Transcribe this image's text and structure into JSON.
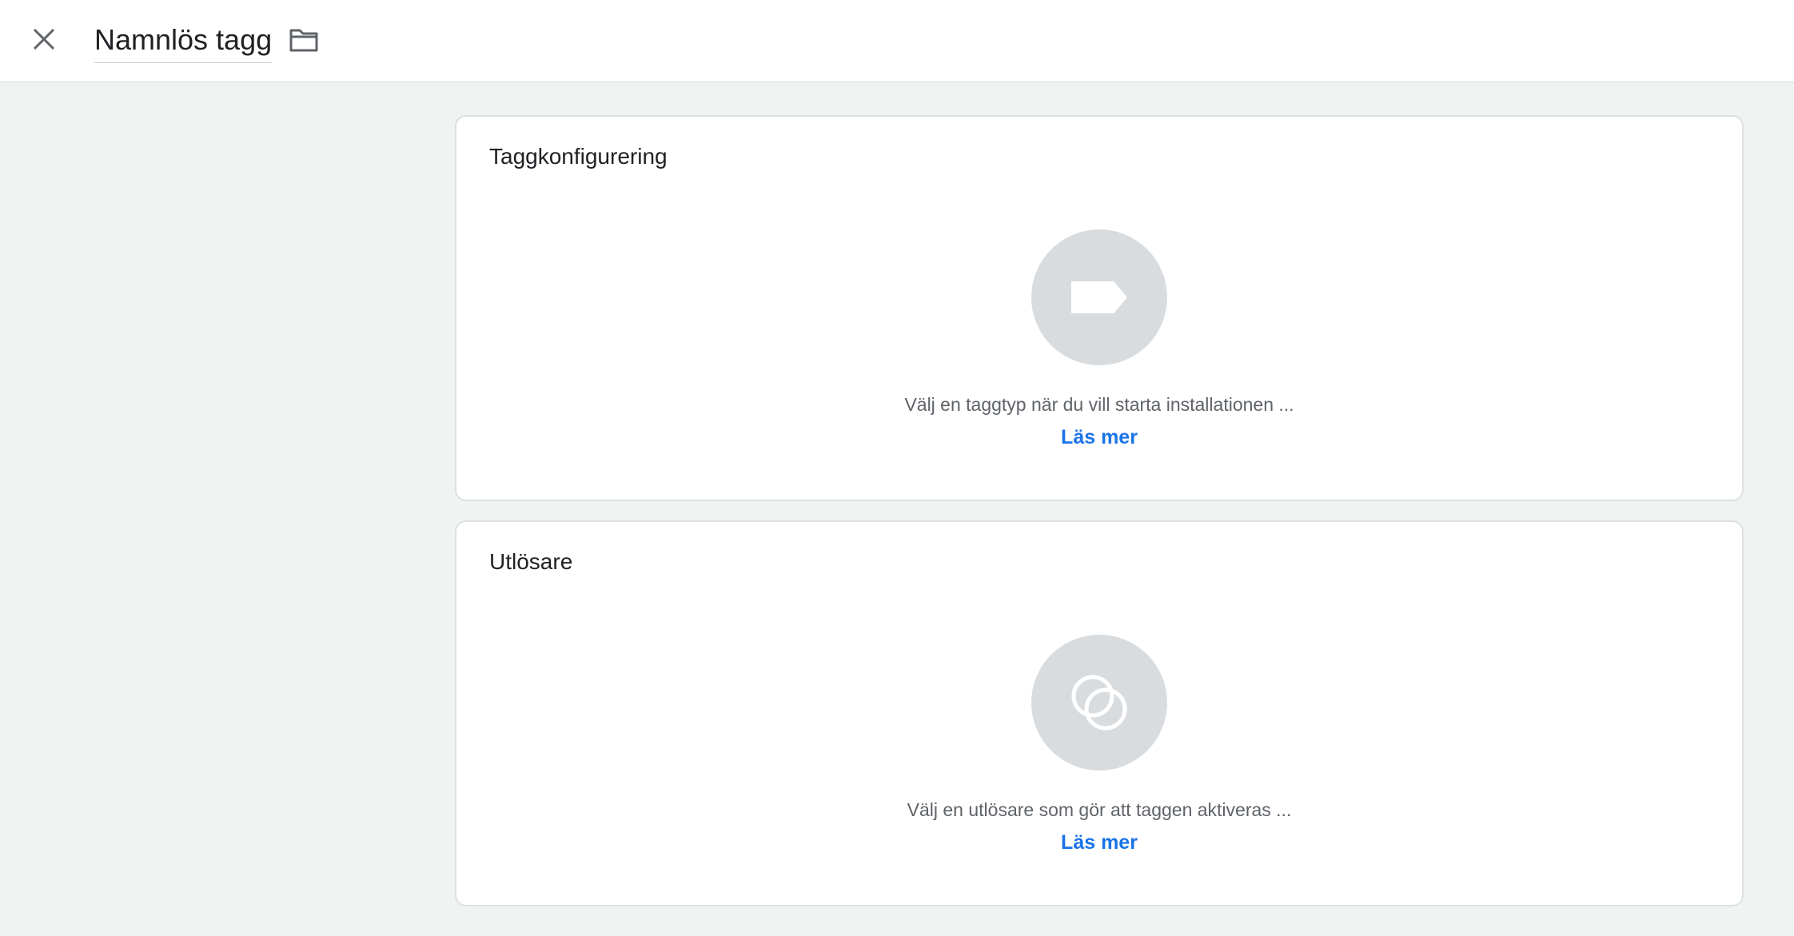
{
  "header": {
    "title": "Namnlös tagg",
    "close_icon": "close-icon",
    "folder_icon": "folder-icon"
  },
  "tag_config": {
    "title": "Taggkonfigurering",
    "icon": "tag-icon",
    "description": "Välj en taggtyp när du vill starta installationen ...",
    "link": "Läs mer"
  },
  "triggers": {
    "title": "Utlösare",
    "icon": "trigger-icon",
    "description": "Välj en utlösare som gör att taggen aktiveras ...",
    "link": "Läs mer"
  },
  "colors": {
    "background": "#eff3f2",
    "card": "#ffffff",
    "placeholder_circle": "#d9dcdf",
    "link": "#1a73e8",
    "muted_text": "#5f6368"
  }
}
